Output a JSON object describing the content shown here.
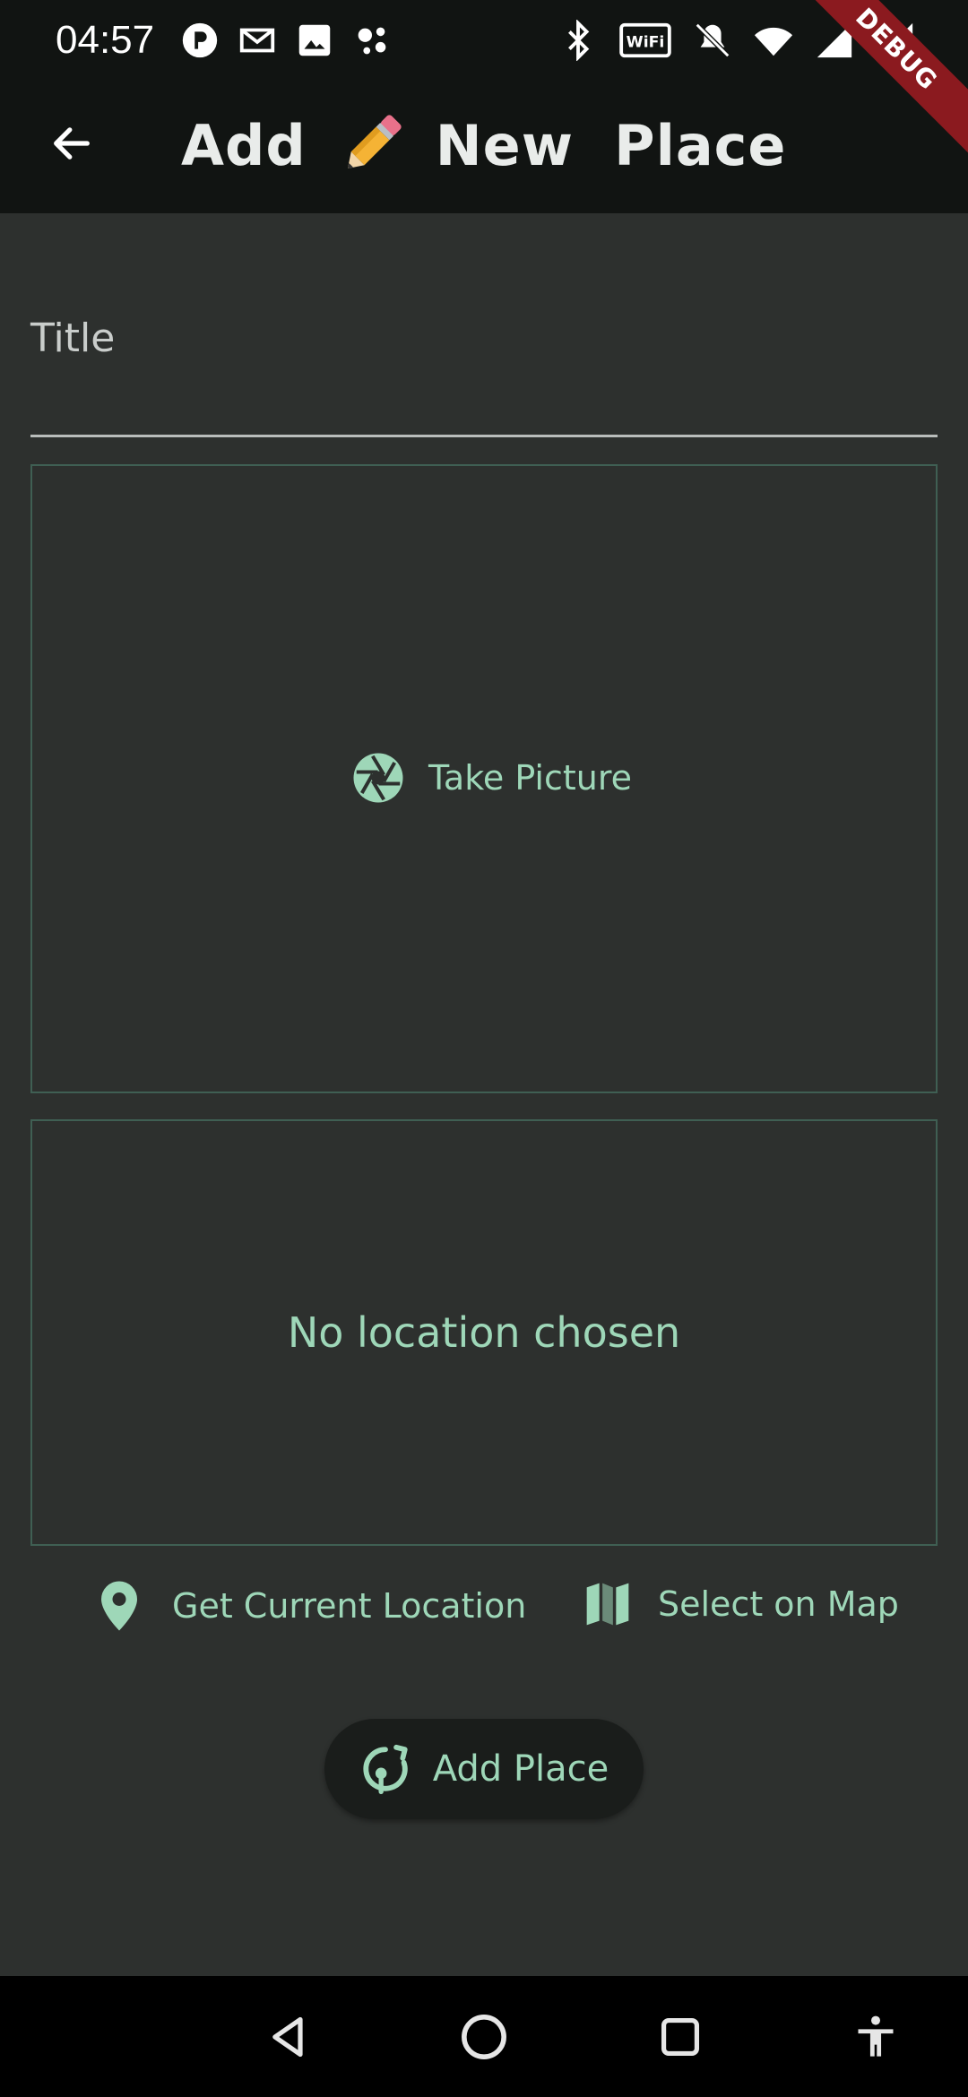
{
  "status_bar": {
    "time": "04:57",
    "left_icons": [
      "notification-app-icon",
      "gmail-icon",
      "gallery-icon",
      "assistant-icon"
    ],
    "right_icons": [
      "bluetooth-icon",
      "vowifi-icon",
      "mute-icon",
      "wifi-icon",
      "signal-icon",
      "signal-roaming-icon"
    ]
  },
  "debug_banner": "DEBUG",
  "app_bar": {
    "title_part1": "Add",
    "title_part2": "New  Place"
  },
  "form": {
    "title_label": "Title",
    "take_picture_label": "Take Picture",
    "no_location_text": "No location chosen",
    "get_location_label": "Get Current Location",
    "select_map_label": "Select on Map",
    "add_place_label": "Add Place"
  },
  "colors": {
    "accent": "#9ed7b8",
    "background": "#2d302e",
    "app_bar": "#111412",
    "border": "#3f5f53"
  },
  "nav_bar": {
    "buttons": [
      "back-triangle-icon",
      "home-circle-icon",
      "recents-square-icon",
      "accessibility-icon"
    ]
  }
}
